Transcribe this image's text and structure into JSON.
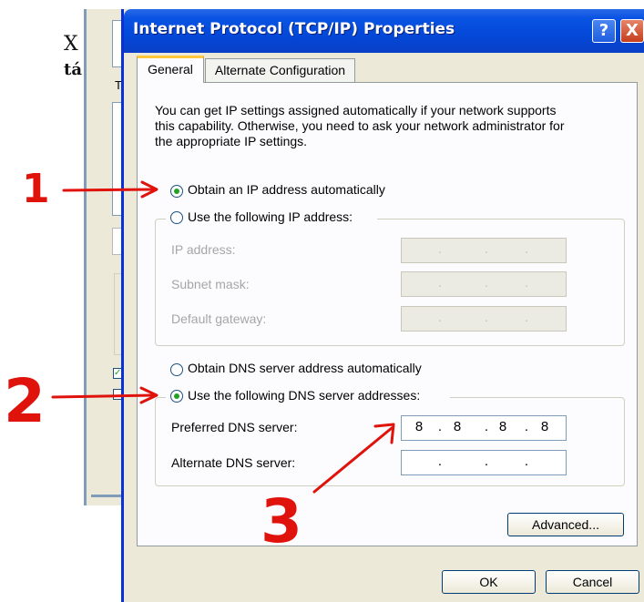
{
  "background_window": {
    "text_line1": "X",
    "text_line2": "tá",
    "label_fragment": "T"
  },
  "window": {
    "title": "Internet Protocol (TCP/IP) Properties",
    "help_label": "?",
    "close_label": "X"
  },
  "tabs": [
    {
      "label": "General",
      "active": true
    },
    {
      "label": "Alternate Configuration",
      "active": false
    }
  ],
  "intro_text": [
    "You can get IP settings assigned automatically if your network supports",
    "this capability. Otherwise, you need to ask your network administrator for",
    "the appropriate IP settings."
  ],
  "ip_options": {
    "auto_label": "Obtain an IP address automatically",
    "manual_label": "Use the following IP address:",
    "selected": "auto"
  },
  "ip_fields": [
    {
      "label": "IP address:",
      "octets": [
        "",
        "",
        "",
        ""
      ]
    },
    {
      "label": "Subnet mask:",
      "octets": [
        "",
        "",
        "",
        ""
      ]
    },
    {
      "label": "Default gateway:",
      "octets": [
        "",
        "",
        "",
        ""
      ]
    }
  ],
  "dns_options": {
    "auto_label": "Obtain DNS server address automatically",
    "manual_label": "Use the following DNS server addresses:",
    "selected": "manual"
  },
  "dns_fields": [
    {
      "label": "Preferred DNS server:",
      "octets": [
        "8",
        "8",
        "8",
        "8"
      ]
    },
    {
      "label": "Alternate DNS server:",
      "octets": [
        "",
        "",
        "",
        ""
      ]
    }
  ],
  "buttons": {
    "advanced": "Advanced...",
    "ok": "OK",
    "cancel": "Cancel"
  },
  "annotations": {
    "step1": "1",
    "step2": "2",
    "step3": "3",
    "color": "#e0120c"
  },
  "colors": {
    "titlebar": "#0348d8",
    "dialog_bg": "#ece9d8",
    "radio_dot": "#21a121",
    "tab_highlight": "#ffc83c"
  }
}
